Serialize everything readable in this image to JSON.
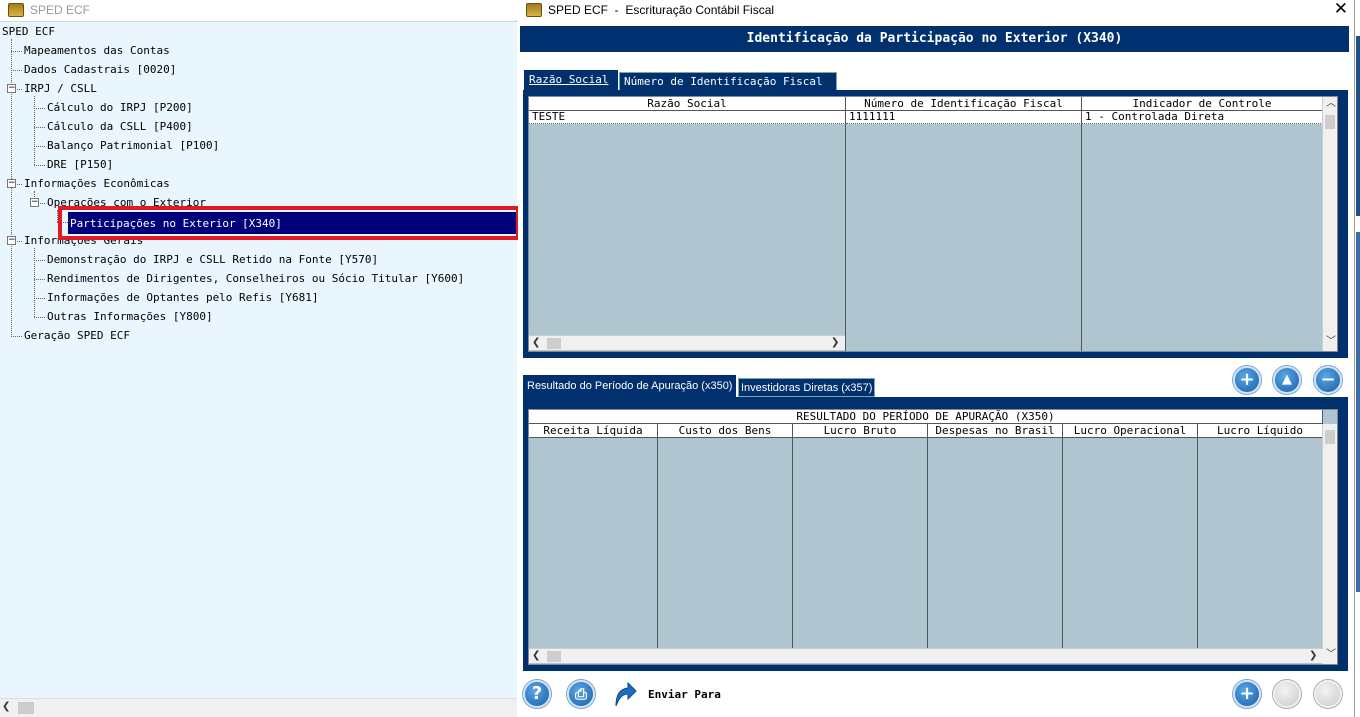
{
  "left_window": {
    "title": "SPED ECF",
    "tree": {
      "root": "SPED ECF",
      "items": [
        "Mapeamentos das Contas",
        "Dados Cadastrais [0020]",
        "IRPJ / CSLL",
        "Cálculo do IRPJ [P200]",
        "Cálculo da CSLL [P400]",
        "Balanço Patrimonial [P100]",
        "DRE [P150]",
        "Informações Econômicas",
        "Operações com o Exterior",
        "Participações no Exterior [X340]",
        "Informações Gerais",
        "Demonstração do IRPJ e CSLL Retido na Fonte [Y570]",
        "Rendimentos de Dirigentes, Conselheiros ou Sócio Titular [Y600]",
        "Informações de Optantes pelo Refis [Y681]",
        "Outras Informações [Y800]",
        "Geração SPED ECF"
      ]
    }
  },
  "right_window": {
    "title": "SPED ECF  -  Escrituração Contábil Fiscal",
    "close_glyph": "✕",
    "banner": "Identificação da Participação no Exterior (X340)",
    "top_tabs": [
      "Razão Social",
      "Número de Identificação Fiscal"
    ],
    "top_grid": {
      "columns": [
        "Razão Social",
        "Número de Identificação Fiscal",
        "Indicador de Controle"
      ],
      "rows": [
        [
          "TESTE",
          "1111111",
          "1 - Controlada Direta"
        ]
      ]
    },
    "bottom_tabs": [
      "Resultado do Período de Apuração (x350)",
      "Investidoras Diretas (x357)"
    ],
    "bottom_grid": {
      "caption": "RESULTADO DO PERÍODO DE APURAÇÃO (X350)",
      "columns": [
        "Receita Líquida",
        "Custo dos Bens",
        "Lucro Bruto",
        "Despesas no Brasil",
        "Lucro Operacional",
        "Lucro Líquido"
      ]
    },
    "buttons": {
      "add": "+",
      "up": "▲",
      "remove": "−",
      "help": "?",
      "print": "⎙",
      "send_label": "Enviar Para"
    }
  }
}
